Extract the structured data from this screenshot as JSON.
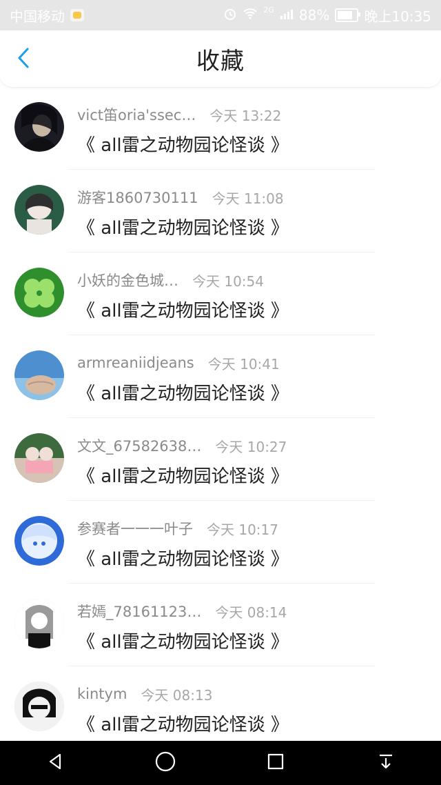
{
  "status_bar": {
    "carrier": "中国移动",
    "network": "2G",
    "battery": "88%",
    "time": "晚上10:35"
  },
  "header": {
    "title": "收藏"
  },
  "favorites": [
    {
      "name": "vict笛oria'ssec…",
      "time": "今天 13:22",
      "title": "《 all雷之动物园论怪谈 》",
      "avatar_colors": [
        "#1b1b24",
        "#c7b8a6"
      ]
    },
    {
      "name": "游客1860730111",
      "time": "今天 11:08",
      "title": "《 all雷之动物园论怪谈 》",
      "avatar_colors": [
        "#2b5d46",
        "#e9e4df"
      ]
    },
    {
      "name": "小妖的金色城…",
      "time": "今天 10:54",
      "title": "《 all雷之动物园论怪谈 》",
      "avatar_colors": [
        "#2f8f2c",
        "#9be06b"
      ]
    },
    {
      "name": "armreaniidjeans",
      "time": "今天 10:41",
      "title": "《 all雷之动物园论怪谈 》",
      "avatar_colors": [
        "#4d8fcf",
        "#d7b9a2"
      ]
    },
    {
      "name": "文文_67582638…",
      "time": "今天 10:27",
      "title": "《 all雷之动物园论怪谈 》",
      "avatar_colors": [
        "#3e6b3d",
        "#d6c3b5"
      ]
    },
    {
      "name": "参赛者一一一叶子",
      "time": "今天 10:17",
      "title": "《 all雷之动物园论怪谈 》",
      "avatar_colors": [
        "#2f6ad9",
        "#e6f0ff"
      ]
    },
    {
      "name": "若嫣_78161123…",
      "time": "今天 08:14",
      "title": "《 all雷之动物园论怪谈 》",
      "avatar_colors": [
        "#9a9a9a",
        "#ffffff"
      ]
    },
    {
      "name": "kintym",
      "time": "今天 08:13",
      "title": "《 all雷之动物园论怪谈 》",
      "avatar_colors": [
        "#111111",
        "#f2f2f2"
      ]
    }
  ],
  "nav_icons": [
    "back-triangle-icon",
    "home-circle-icon",
    "recents-square-icon",
    "notification-download-icon"
  ]
}
